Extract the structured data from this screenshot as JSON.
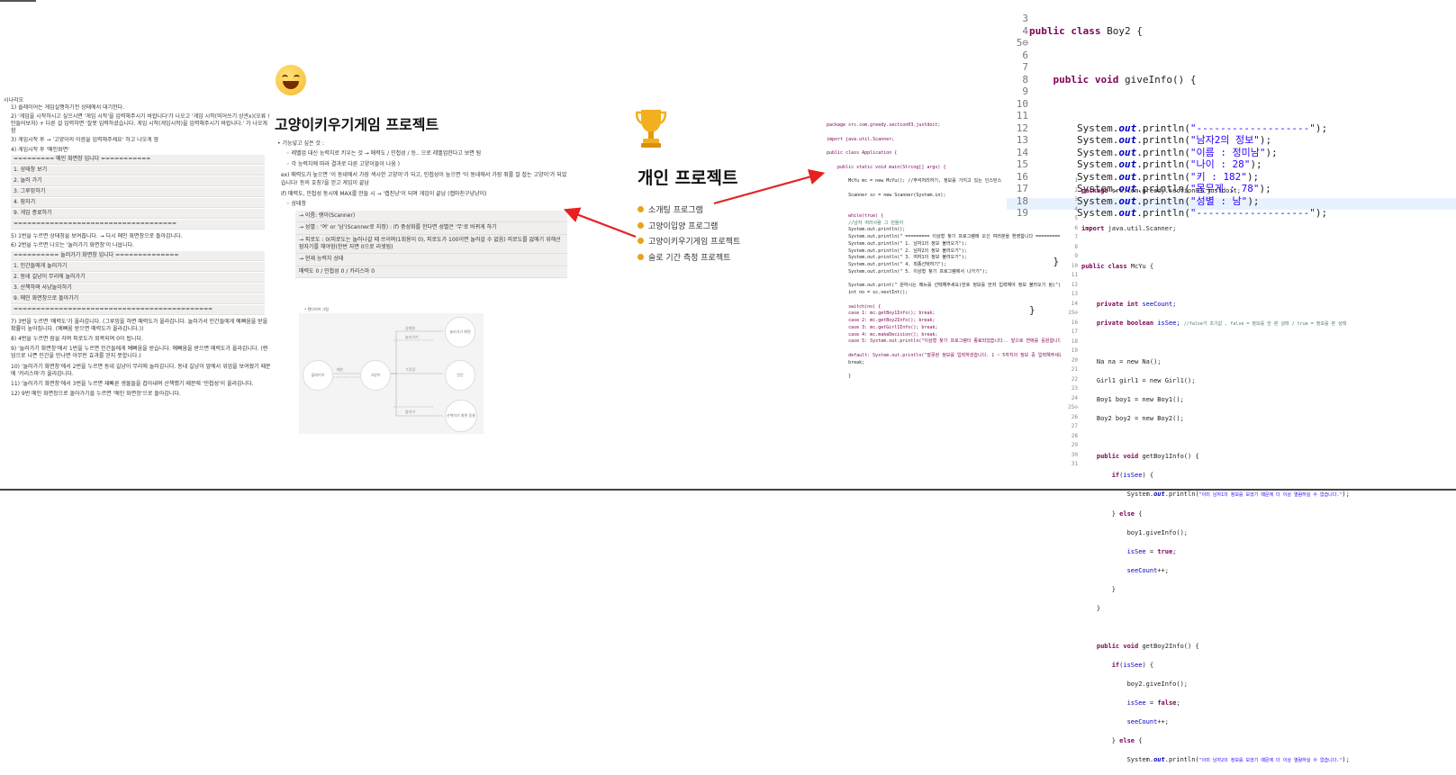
{
  "notes": {
    "bullet": "시나리오",
    "lines": [
      "1) 플레이어는 게임실행하기전 상태에서 대기한다.",
      "2) '게임을 시작하시고 싶으시면 '게임 시작'을 입력해주시기 바랍니다'가 나오고 '게임 시작(띄어쓰기 상관x)(오류 ! 만들어보자) + 다른 걸 입력하면 '잘못 입력하셨습니다. 게임 시작(게임시작)을 입력해주시기 바랍니다.' 가 나오게 함",
      "3) 게임시작 후 → '고양이의 이름을 입력해주세요' 하고 나오게 함",
      "4) 게임시작 후 '메인화면'"
    ],
    "menu_header": "========= 메인 화면창 입니다 ===========",
    "menu_items": [
      "1. 상태창 보기",
      "2. 놀러 가기",
      "3. 그루밍하기",
      "4. 잠자기",
      "9. 게임 종료하기"
    ],
    "menu_sep": "====================================",
    "mid_lines": [
      "5) 1번을 누르면 상태창을 보여줍니다. → 다시 메인 화면창으로 돌아갑니다.",
      "6) 2번을 누르면 나오는 '놀러가기 화면창'이 나옵니다."
    ],
    "play_header": "========== 놀러가기 화면창 입니다 ==============",
    "play_items": [
      "1. 인간들에게 놀러가기",
      "2. 동네 길냥이 무리에 놀러가기",
      "3. 산책하며 사냥놀이하기",
      "9. 메인 화면창으로 돌아가기"
    ],
    "play_sep": "============================================",
    "tail_lines": [
      "7) 3번을 누르면 '매력도'가 올라갑니다. (그루밍을 하면 매력도가 올라갑니다. 놀러가서 인간들에게 예뻐움을 받을 확률이 높아집니다. (예뻐움 받으면 매력도가 올라갑니다.))",
      "8) 4번을 누르면 잠을 자며 피로도가 회복되며 0이 됩니다.",
      "9) '놀러가기 화면창'에서 1번을 누르면 인간들에게 예뻐움을 받습니다. 예뻐움을 받으면 매력도가 올라갑니다. (랜덤으로 나쁜 인간을 만나면 아무런 효과를 얻지 못합니다.)",
      "10) '놀러가기 화면창'에서 2번을 누르면 동네 길냥이 무리에 놀러갑니다. 동네 길냥이 앞에서 위엄을 보여줬기 때문에 '카리스마'가 올라갑니다.",
      "11) '놀러가기 화면창'에서 3번을 누르면 재빠른 생물들을 잡아내며 산책했기 때문에 '민첩성'이 올라갑니다.",
      "12) 9번 메인 화면창으로 돌아가기를 누르면 '메인 화면창'으로 돌아갑니다."
    ]
  },
  "cat_page": {
    "title": "고양이키우기게임 프로젝트",
    "feature_head": "기능넣고 싶은 것 :",
    "features": [
      "레벨업 대신 능력치로 키우는 것 → 매력도 / 민첩성 / 등.. 으로 레벨업한다고 보면 됨",
      "각 능력치에 따라 결과로 다른 고양이들이 나옴 )"
    ],
    "ex1": "ex) 매력도가 높으면 '이 동네에서 가장 섹시한 고양이'가 되고, 민첩성이 높으면 '이 동네에서 가장 쥐를 잘 잡는 고양이'가 되었습니다! 등의 호칭?을 얻고 게임이 끝남",
    "ex2": "if) 매력도, 민첩성 동시에 MAX를 만들 시 → '캡친냥'이 되며 게임이 끝남 (캡마친구냥냥이)",
    "status_head": "상태창",
    "status_box": [
      "→ 이름: 랭이(Scanner)",
      "→ 성별 : '여' or '남'(Scanner로 지정) : if) 중성화를 한다면 성별은 '무'로 바뀌게 하기",
      "→ 피로도 : 0(피로도는 놀러나갈 때 쓰이며(1회용이 0), 피로도가 100이면 놀러갈 수 없음) 피로도를 없애기 위해선 잠자기를 해야함(한번 자면 0으로 리셋됨)",
      "→ 현재 능력치 상태",
      "매력도 0 / 민첩성 0 / 카리스마 0"
    ],
    "diagram_caption": "• 텐다이어 그림",
    "diagram_nodes": [
      "플레이어",
      "고양이",
      "놀러가기 화면",
      "인간",
      "산책하기 화면 동물"
    ],
    "diagram_labels": [
      "메인",
      "상태창",
      "놀러가기",
      "그루밍",
      "잠자기"
    ]
  },
  "projects": {
    "title": "개인 프로젝트",
    "items": [
      "소개팅 프로그램",
      "고양이입양 프로그램",
      "고양이키우기게임 프로젝트",
      "슬로 기간 측정 프로젝트"
    ],
    "accent": "#e82020"
  },
  "code_app": {
    "lines": [
      "package src.com.greedy.section03.justdoit;",
      "",
      "import java.util.Scanner;",
      "",
      "public class Application {",
      "",
      "    public static void main(String[] args) {",
      "",
      "        McYu mc = new McYu(); //주석처리하기, 정보를 가지고 있는 인스턴스",
      "",
      "        Scanner sc = new Scanner(System.in);",
      "",
      "",
      "        while(true) {",
      "        //남자 여러사람 그 만들어",
      "        System.out.println();",
      "        System.out.println(\" ========= 이상형 찾기 프로그램에 오신 여러분을 환영합니다 =========\");",
      "        System.out.println(\" 1. 남자1의 정보 불러오기\");",
      "        System.out.println(\" 2. 남자2의 정보 불러오기\");",
      "        System.out.println(\" 3. 여자1의 정보 불러오기\");",
      "        System.out.println(\" 4. 최종선택하기\");",
      "        System.out.println(\" 5. 이상형 찾기 프로그램에서 나가기\");",
      "",
      "        System.out.print(\" 원하시는 메뉴를 선택해주세요(번호 정보를 먼저 입력해야 정보 불러오기 됨)\");",
      "        int no = sc.nextInt();",
      "",
      "        switch(no) {",
      "        case 1: mc.getBoy1Info(); break;",
      "        case 2: mc.getBoy2Info(); break;",
      "        case 3: mc.getGirl1Info(); break;",
      "        case 4: mc.makeDecision(); break;",
      "        case 5: System.out.println(\"이상형 찾기 프로그램이 종료되었습니다.. 앞으로 연애를 응원합니다\");",
      "",
      "        default: System.out.println(\"잘못된 정보를 입력하셨습니다. 1 ~ 5까지의 정보 중 입력해주세요\");",
      "        break;",
      "",
      "        }"
    ]
  },
  "code_boy2": {
    "line_numbers": [
      "3",
      "4",
      "5⊖",
      "6",
      "7",
      "8",
      "9",
      "10",
      "11",
      "12",
      "13",
      "14",
      "15",
      "16",
      "17",
      "18",
      "19"
    ],
    "class_decl": "Boy2",
    "method_decl": "giveInfo",
    "prints": [
      "\"-------------------\"",
      "\"남자2의 정보\"",
      "\"이름 : 정미남\"",
      "\"나이 : 28\"",
      "\"키 : 182\"",
      "\"몸무게 : 78\"",
      "\"성별 : 남\"",
      "\"-------------------\""
    ]
  },
  "code_mcyu": {
    "line_numbers": [
      "1",
      "2",
      "3",
      "4",
      "5",
      "6",
      "7",
      "8",
      "9",
      "10",
      "11",
      "12",
      "13",
      "14",
      "15⊖",
      "16",
      "17",
      "18",
      "19",
      "20",
      "21",
      "22",
      "23",
      "24",
      "25⊖",
      "26",
      "27",
      "28",
      "29",
      "30",
      "31"
    ],
    "package": "src.com.greedy.section03.justdoit;",
    "import": "java.util.Scanner;",
    "class_name": "McYu",
    "field1": "seeCount;",
    "field2": "isSee;",
    "field2_comment": "//false가 초기값 , false = 정보를 안 본 상태 / true = 정보를 본 상태",
    "inst1": "Na na = new Na();",
    "inst2": "Girl1 girl1 = new Girl1();",
    "inst3": "Boy1 boy1 = new Boy1();",
    "inst4": "Boy2 boy2 = new Boy2();",
    "m1": "getBoy1Info",
    "m2": "getBoy2Info",
    "msg1": "\"이미 남자1의 정보를 보셨기 때문에 더 이상 열람하실 수 없습니다.\"",
    "msg2": "\"이미 남자2의 정보를 보셨기 때문에 더 이상 열람하실 수 없습니다.\"",
    "giveInfo1": "boy1.giveInfo();",
    "giveInfo2": "boy2.giveInfo();"
  }
}
